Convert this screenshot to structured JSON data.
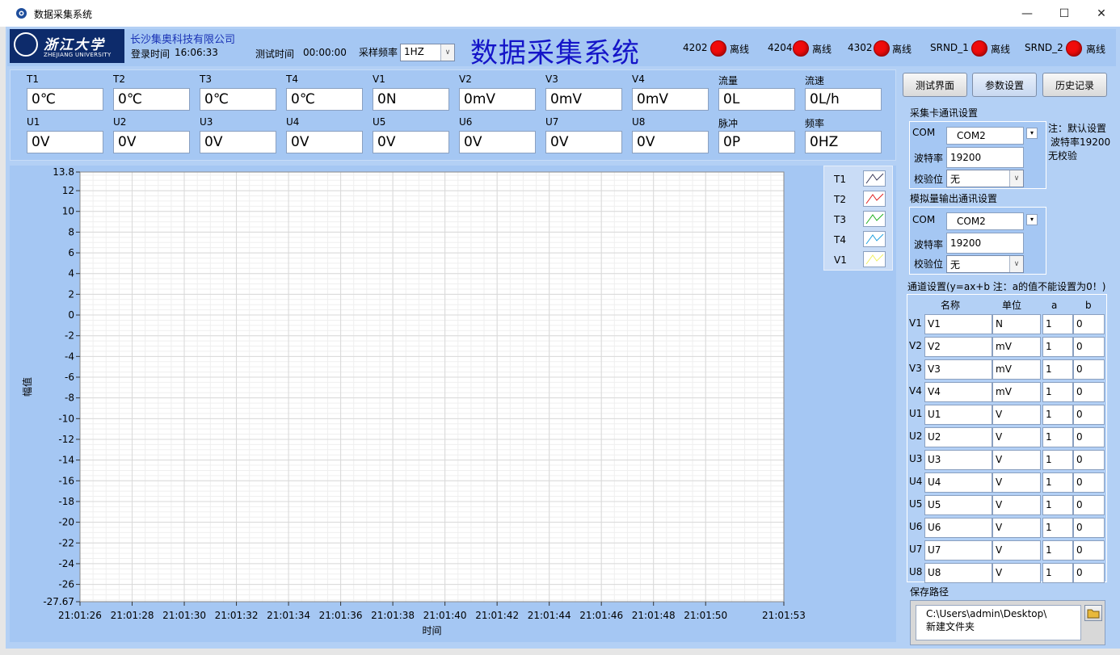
{
  "window": {
    "title": "数据采集系统",
    "minimize": "—",
    "maximize": "☐",
    "close": "✕"
  },
  "logo": {
    "name_zh": "浙江大学",
    "name_en": "ZHEJIANG UNIVERSITY"
  },
  "header": {
    "company": "长沙集奥科技有限公司",
    "login_label": "登录时间",
    "login_time": "16:06:33",
    "test_time_label": "测试时间",
    "test_time": "00:00:00",
    "sample_rate_label": "采样频率",
    "sample_rate": "1HZ",
    "title": "数据采集系统",
    "devices": [
      {
        "name": "4202",
        "status": "离线",
        "color": "#f00b0b"
      },
      {
        "name": "4204",
        "status": "离线",
        "color": "#f00b0b"
      },
      {
        "name": "4302",
        "status": "离线",
        "color": "#f00b0b"
      },
      {
        "name": "SRND_1",
        "status": "离线",
        "color": "#f00b0b"
      },
      {
        "name": "SRND_2",
        "status": "离线",
        "color": "#f00b0b"
      }
    ]
  },
  "readings_row1": [
    {
      "label": "T1",
      "value": "0℃"
    },
    {
      "label": "T2",
      "value": "0℃"
    },
    {
      "label": "T3",
      "value": "0℃"
    },
    {
      "label": "T4",
      "value": "0℃"
    },
    {
      "label": "V1",
      "value": "0N"
    },
    {
      "label": "V2",
      "value": "0mV"
    },
    {
      "label": "V3",
      "value": "0mV"
    },
    {
      "label": "V4",
      "value": "0mV"
    },
    {
      "label": "流量",
      "value": "0L"
    },
    {
      "label": "流速",
      "value": "0L/h"
    }
  ],
  "readings_row2": [
    {
      "label": "U1",
      "value": "0V"
    },
    {
      "label": "U2",
      "value": "0V"
    },
    {
      "label": "U3",
      "value": "0V"
    },
    {
      "label": "U4",
      "value": "0V"
    },
    {
      "label": "U5",
      "value": "0V"
    },
    {
      "label": "U6",
      "value": "0V"
    },
    {
      "label": "U7",
      "value": "0V"
    },
    {
      "label": "U8",
      "value": "0V"
    },
    {
      "label": "脉冲",
      "value": "0P"
    },
    {
      "label": "频率",
      "value": "0HZ"
    }
  ],
  "chart_data": {
    "type": "line",
    "title": "",
    "xlabel": "时间",
    "ylabel": "幅值",
    "ylim": [
      -27.67,
      13.8
    ],
    "y_ticks": [
      "13.8",
      "12",
      "10",
      "8",
      "6",
      "4",
      "2",
      "0",
      "-2",
      "-4",
      "-6",
      "-8",
      "-10",
      "-12",
      "-14",
      "-16",
      "-18",
      "-20",
      "-22",
      "-24",
      "-26",
      "-27.67"
    ],
    "x_ticks": [
      "21:01:26",
      "21:01:28",
      "21:01:30",
      "21:01:32",
      "21:01:34",
      "21:01:36",
      "21:01:38",
      "21:01:40",
      "21:01:42",
      "21:01:44",
      "21:01:46",
      "21:01:48",
      "21:01:50",
      "21:01:53"
    ],
    "x_range": [
      "21:01:26",
      "21:01:53"
    ],
    "grid": true,
    "legend_position": "top-right",
    "series": [
      {
        "name": "T1",
        "color": "#3a3a5a",
        "values": []
      },
      {
        "name": "T2",
        "color": "#e02020",
        "values": []
      },
      {
        "name": "T3",
        "color": "#20b020",
        "values": []
      },
      {
        "name": "T4",
        "color": "#20a0e0",
        "values": []
      },
      {
        "name": "V1",
        "color": "#f0f060",
        "values": []
      }
    ]
  },
  "nav": {
    "test": "测试界面",
    "params": "参数设置",
    "history": "历史记录"
  },
  "card_comm": {
    "title": "采集卡通讯设置",
    "com_label": "COM",
    "com_value": "COM2",
    "baud_label": "波特率",
    "baud_value": "19200",
    "parity_label": "校验位",
    "parity_value": "无"
  },
  "note": {
    "line1": "注：默认设置",
    "line2": "波特率19200",
    "line3": "无校验"
  },
  "analog_comm": {
    "title": "模拟量输出通讯设置",
    "com_label": "COM",
    "com_value": "COM2",
    "baud_label": "波特率",
    "baud_value": "19200",
    "parity_label": "校验位",
    "parity_value": "无"
  },
  "channels": {
    "title": "通道设置(y=ax+b 注：a的值不能设置为0！)",
    "headers": {
      "name": "名称",
      "unit": "单位",
      "a": "a",
      "b": "b"
    },
    "rows": [
      {
        "id": "V1",
        "name": "V1",
        "unit": "N",
        "a": "1",
        "b": "0"
      },
      {
        "id": "V2",
        "name": "V2",
        "unit": "mV",
        "a": "1",
        "b": "0"
      },
      {
        "id": "V3",
        "name": "V3",
        "unit": "mV",
        "a": "1",
        "b": "0"
      },
      {
        "id": "V4",
        "name": "V4",
        "unit": "mV",
        "a": "1",
        "b": "0"
      },
      {
        "id": "U1",
        "name": "U1",
        "unit": "V",
        "a": "1",
        "b": "0"
      },
      {
        "id": "U2",
        "name": "U2",
        "unit": "V",
        "a": "1",
        "b": "0"
      },
      {
        "id": "U3",
        "name": "U3",
        "unit": "V",
        "a": "1",
        "b": "0"
      },
      {
        "id": "U4",
        "name": "U4",
        "unit": "V",
        "a": "1",
        "b": "0"
      },
      {
        "id": "U5",
        "name": "U5",
        "unit": "V",
        "a": "1",
        "b": "0"
      },
      {
        "id": "U6",
        "name": "U6",
        "unit": "V",
        "a": "1",
        "b": "0"
      },
      {
        "id": "U7",
        "name": "U7",
        "unit": "V",
        "a": "1",
        "b": "0"
      },
      {
        "id": "U8",
        "name": "U8",
        "unit": "V",
        "a": "1",
        "b": "0"
      }
    ]
  },
  "save_path": {
    "label": "保存路径",
    "line1": "C:\\Users\\admin\\Desktop\\",
    "line2": "新建文件夹"
  }
}
